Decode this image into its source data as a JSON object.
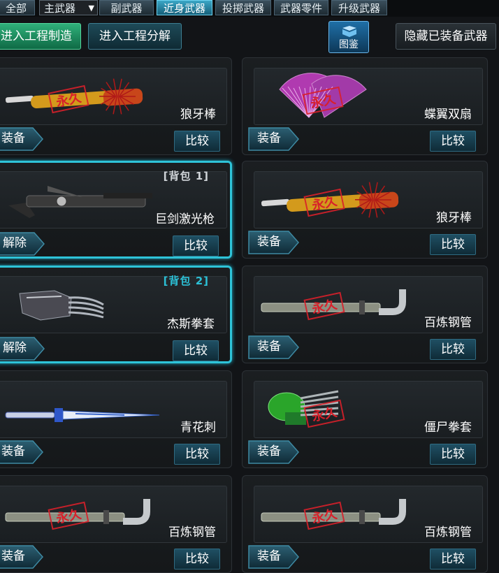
{
  "tabs": [
    {
      "label": "全部"
    },
    {
      "label": "主武器"
    },
    {
      "label": "副武器"
    },
    {
      "label": "近身武器"
    },
    {
      "label": "投掷武器"
    },
    {
      "label": "武器零件"
    },
    {
      "label": "升级武器"
    }
  ],
  "actions": {
    "craft_label": "进入工程制造",
    "dismantle_label": "进入工程分解",
    "codex_label": "图鉴",
    "hide_label": "隐藏已装备武器"
  },
  "cards": [
    {
      "name": "狼牙棒",
      "action": "装备",
      "compare": "比较",
      "bag": "",
      "permanent": "永久"
    },
    {
      "name": "蝶翼双扇",
      "action": "装备",
      "compare": "比较",
      "bag": "",
      "permanent": "永久"
    },
    {
      "name": "巨剑激光枪",
      "action": "解除",
      "compare": "比较",
      "bag": "[背包 1]",
      "permanent": ""
    },
    {
      "name": "狼牙棒",
      "action": "装备",
      "compare": "比较",
      "bag": "",
      "permanent": "永久"
    },
    {
      "name": "杰斯拳套",
      "action": "解除",
      "compare": "比较",
      "bag": "[背包 2]",
      "permanent": ""
    },
    {
      "name": "百炼钢管",
      "action": "装备",
      "compare": "比较",
      "bag": "",
      "permanent": "永久"
    },
    {
      "name": "青花刺",
      "action": "装备",
      "compare": "比较",
      "bag": "",
      "permanent": ""
    },
    {
      "name": "僵尸拳套",
      "action": "装备",
      "compare": "比较",
      "bag": "",
      "permanent": "永久"
    },
    {
      "name": "百炼钢管",
      "action": "装备",
      "compare": "比较",
      "bag": "",
      "permanent": "永久"
    },
    {
      "name": "百炼钢管",
      "action": "装备",
      "compare": "比较",
      "bag": "",
      "permanent": "永久"
    }
  ],
  "colors": {
    "accent": "#2ec3d8",
    "stamp": "#d8202a",
    "green": "#1f9a66"
  }
}
